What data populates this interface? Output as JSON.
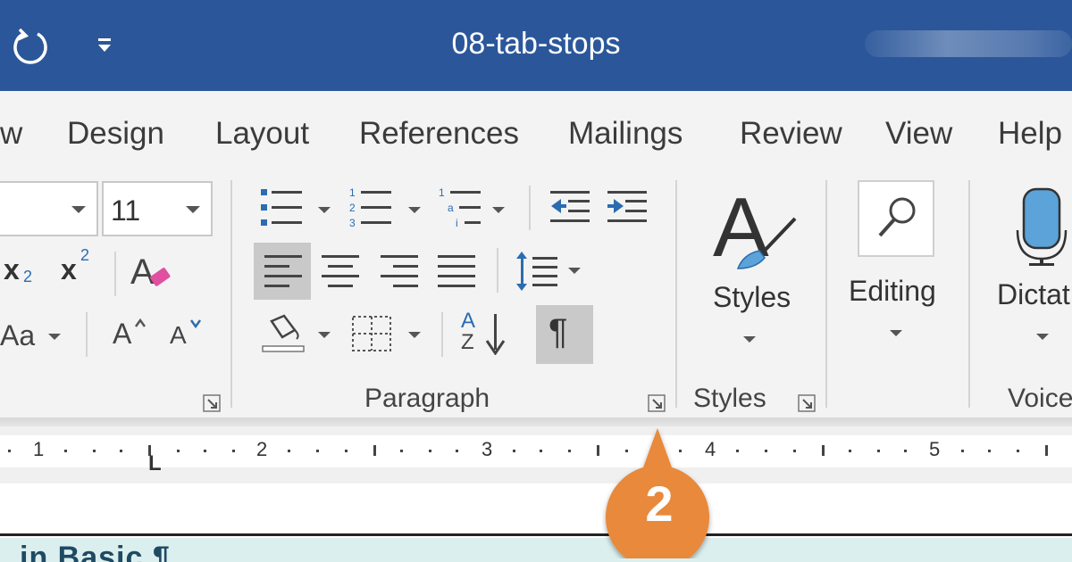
{
  "title_bar": {
    "doc_title": "08-tab-stops",
    "redo_icon": "redo-icon",
    "customize_icon": "customize-qat-icon",
    "bg_color": "#2b579a"
  },
  "tabs": [
    {
      "label": "w"
    },
    {
      "label": "Design"
    },
    {
      "label": "Layout"
    },
    {
      "label": "References"
    },
    {
      "label": "Mailings"
    },
    {
      "label": "Review"
    },
    {
      "label": "View"
    },
    {
      "label": "Help"
    }
  ],
  "font_group": {
    "font_size_value": "11",
    "subscript_label": "x",
    "subscript_mark": "2",
    "superscript_label": "x",
    "superscript_mark": "2",
    "change_case_label": "Aa",
    "grow_label": "A",
    "shrink_label": "A"
  },
  "paragraph_group": {
    "label": "Paragraph",
    "sort_top": "A",
    "sort_bottom": "Z",
    "pilcrow": "¶"
  },
  "styles_group": {
    "button_label": "Styles",
    "group_label": "Styles",
    "glyph": "A"
  },
  "editing_group": {
    "button_label": "Editing"
  },
  "voice_group": {
    "button_label": "Dictat",
    "group_label": "Voice"
  },
  "ruler": {
    "numbers": [
      "1",
      "2",
      "3",
      "4",
      "5"
    ],
    "tab_marker": "L"
  },
  "document": {
    "visible_text": "  in Basic ¶"
  },
  "callout": {
    "number": "2",
    "color": "#e8893a"
  }
}
